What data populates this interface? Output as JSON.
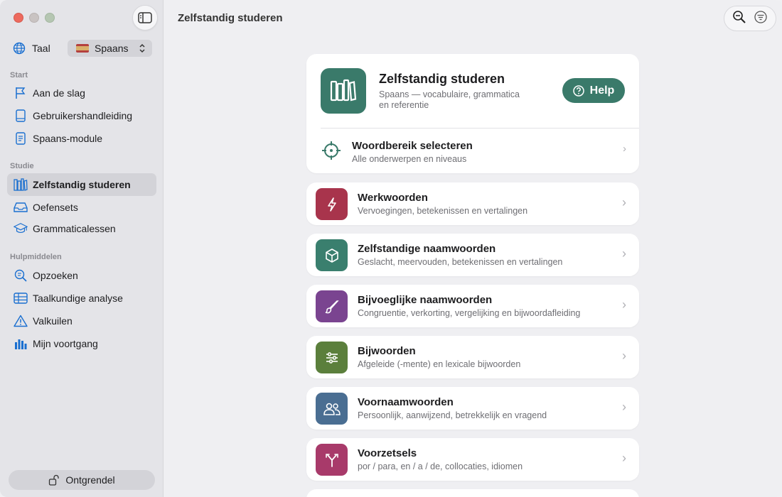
{
  "sidebar": {
    "language_label": "Taal",
    "language_value": "Spaans",
    "sections": {
      "start": "Start",
      "study": "Studie",
      "tools": "Hulpmiddelen"
    },
    "items": [
      {
        "label": "Aan de slag"
      },
      {
        "label": "Gebruikershandleiding"
      },
      {
        "label": "Spaans-module"
      },
      {
        "label": "Zelfstandig studeren"
      },
      {
        "label": "Oefensets"
      },
      {
        "label": "Grammaticalessen"
      },
      {
        "label": "Opzoeken"
      },
      {
        "label": "Taalkundige analyse"
      },
      {
        "label": "Valkuilen"
      },
      {
        "label": "Mijn voortgang"
      }
    ],
    "unlock_label": "Ontgrendel"
  },
  "header": {
    "title": "Zelfstandig studeren"
  },
  "hero": {
    "title": "Zelfstandig studeren",
    "subtitle": "Spaans — vocabulaire, grammatica en referentie",
    "help_label": "Help",
    "range_title": "Woordbereik selecteren",
    "range_subtitle": "Alle onderwerpen en niveaus"
  },
  "topics": [
    {
      "title": "Werkwoorden",
      "subtitle": "Vervoegingen, betekenissen en vertalingen",
      "color": "#a8344c"
    },
    {
      "title": "Zelfstandige naamwoorden",
      "subtitle": "Geslacht, meervouden, betekenissen en vertalingen",
      "color": "#3a7f6e"
    },
    {
      "title": "Bijvoeglijke naamwoorden",
      "subtitle": "Congruentie, verkorting, vergelijking en bijwoordafleiding",
      "color": "#7a4490"
    },
    {
      "title": "Bijwoorden",
      "subtitle": "Afgeleide (-mente) en lexicale bijwoorden",
      "color": "#5b7f3c"
    },
    {
      "title": "Voornaamwoorden",
      "subtitle": "Persoonlijk, aanwijzend, betrekkelijk en vragend",
      "color": "#4a6e92"
    },
    {
      "title": "Voorzetsels",
      "subtitle": "por / para, en / a / de, collocaties, idiomen",
      "color": "#a83a6a"
    }
  ],
  "colors": {
    "accent": "#3a7a6a",
    "sidebar_icon": "#1a6fd0"
  }
}
